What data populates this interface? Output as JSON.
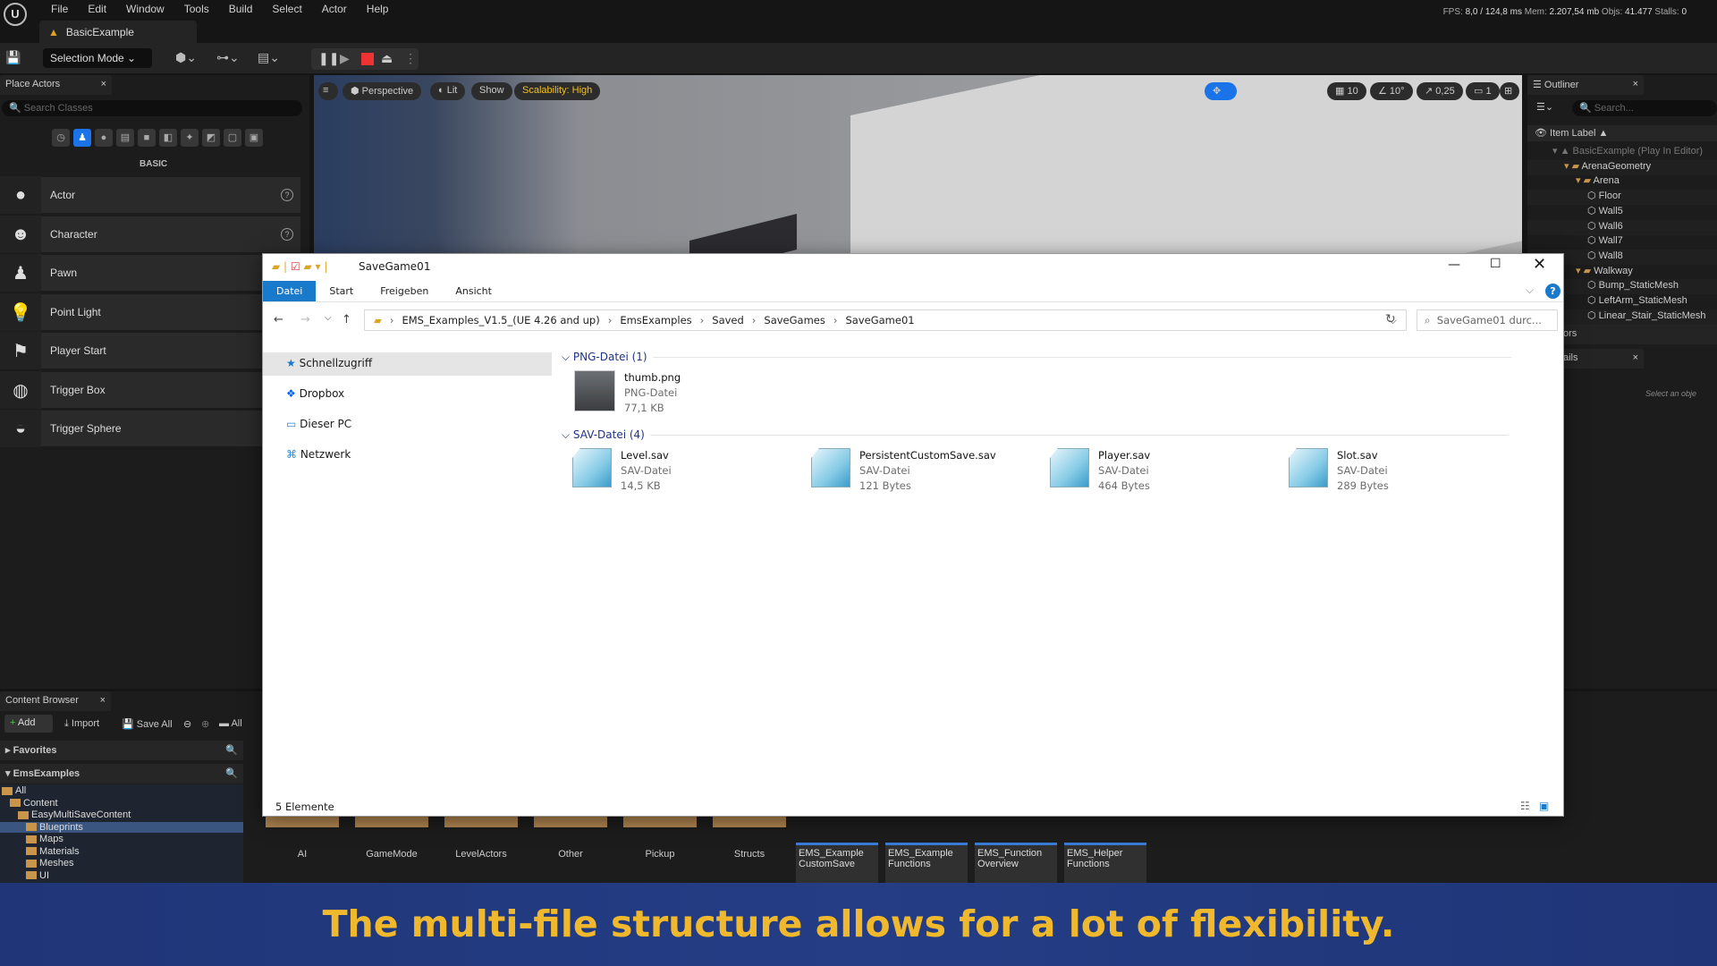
{
  "app": {
    "menu": [
      "File",
      "Edit",
      "Window",
      "Tools",
      "Build",
      "Select",
      "Actor",
      "Help"
    ],
    "doc_tab": "BasicExample",
    "stats": {
      "fps_label": "FPS:",
      "fps": "8,0",
      "ms": "/ 124,8 ms",
      "mem_label": "Mem:",
      "mem": "2.207,54 mb",
      "objs_label": "Objs:",
      "objs": "41.477",
      "stalls_label": "Stalls:",
      "stalls": "0"
    },
    "selection_mode": "Selection Mode"
  },
  "place_actors": {
    "title": "Place Actors",
    "search_placeholder": "Search Classes",
    "section": "BASIC",
    "items": [
      "Actor",
      "Character",
      "Pawn",
      "Point Light",
      "Player Start",
      "Trigger Box",
      "Trigger Sphere"
    ]
  },
  "viewport": {
    "perspective": "Perspective",
    "lit": "Lit",
    "show": "Show",
    "scalability": "Scalability: High",
    "grid": "10",
    "angle": "10°",
    "scale": "0,25",
    "camera": "1"
  },
  "outliner": {
    "title": "Outliner",
    "search_placeholder": "Search...",
    "column": "Item Label",
    "rows": [
      {
        "label": "BasicExample (Play In Editor)",
        "depth": 0,
        "type": "world"
      },
      {
        "label": "ArenaGeometry",
        "depth": 1,
        "type": "folder"
      },
      {
        "label": "Arena",
        "depth": 2,
        "type": "folder"
      },
      {
        "label": "Floor",
        "depth": 3,
        "type": "mesh"
      },
      {
        "label": "Wall5",
        "depth": 3,
        "type": "mesh"
      },
      {
        "label": "Wall6",
        "depth": 3,
        "type": "mesh"
      },
      {
        "label": "Wall7",
        "depth": 3,
        "type": "mesh"
      },
      {
        "label": "Wall8",
        "depth": 3,
        "type": "mesh"
      },
      {
        "label": "Walkway",
        "depth": 2,
        "type": "folder"
      },
      {
        "label": "Bump_StaticMesh",
        "depth": 3,
        "type": "mesh"
      },
      {
        "label": "LeftArm_StaticMesh",
        "depth": 3,
        "type": "mesh"
      },
      {
        "label": "Linear_Stair_StaticMesh",
        "depth": 3,
        "type": "mesh"
      }
    ],
    "partial_tab": "ors",
    "details_tab": "ails",
    "details_hint": "Select an obje"
  },
  "content_browser": {
    "title": "Content Browser",
    "add": "Add",
    "import": "Import",
    "save_all": "Save All",
    "path": "All",
    "favorites": "Favorites",
    "root": "EmsExamples",
    "tree": [
      {
        "label": "All",
        "depth": 0
      },
      {
        "label": "Content",
        "depth": 1
      },
      {
        "label": "EasyMultiSaveContent",
        "depth": 2
      },
      {
        "label": "Blueprints",
        "depth": 3,
        "selected": true
      },
      {
        "label": "Maps",
        "depth": 3
      },
      {
        "label": "Materials",
        "depth": 3
      },
      {
        "label": "Meshes",
        "depth": 3
      },
      {
        "label": "UI",
        "depth": 3
      }
    ],
    "folders": [
      "AI",
      "GameMode",
      "LevelActors",
      "Other",
      "Pickup",
      "Structs"
    ],
    "assets": [
      [
        "EMS_Example",
        "CustomSave"
      ],
      [
        "EMS_Example",
        "Functions"
      ],
      [
        "EMS_Function",
        "Overview"
      ],
      [
        "EMS_Helper",
        "Functions"
      ]
    ]
  },
  "explorer": {
    "title": "SaveGame01",
    "ribbon": [
      "Datei",
      "Start",
      "Freigeben",
      "Ansicht"
    ],
    "breadcrumb": [
      "EMS_Examples_V1.5_(UE 4.26 and up)",
      "EmsExamples",
      "Saved",
      "SaveGames",
      "SaveGame01"
    ],
    "search_placeholder": "SaveGame01 durc...",
    "nav": [
      "Schnellzugriff",
      "Dropbox",
      "Dieser PC",
      "Netzwerk"
    ],
    "groups": [
      {
        "header": "PNG-Datei (1)",
        "files": [
          {
            "name": "thumb.png",
            "type": "PNG-Datei",
            "size": "77,1 KB"
          }
        ]
      },
      {
        "header": "SAV-Datei (4)",
        "files": [
          {
            "name": "Level.sav",
            "type": "SAV-Datei",
            "size": "14,5 KB"
          },
          {
            "name": "PersistentCustomSave.sav",
            "type": "SAV-Datei",
            "size": "121 Bytes"
          },
          {
            "name": "Player.sav",
            "type": "SAV-Datei",
            "size": "464 Bytes"
          },
          {
            "name": "Slot.sav",
            "type": "SAV-Datei",
            "size": "289 Bytes"
          }
        ]
      }
    ],
    "status": "5 Elemente"
  },
  "caption": "The multi-file structure allows for a lot of flexibility."
}
